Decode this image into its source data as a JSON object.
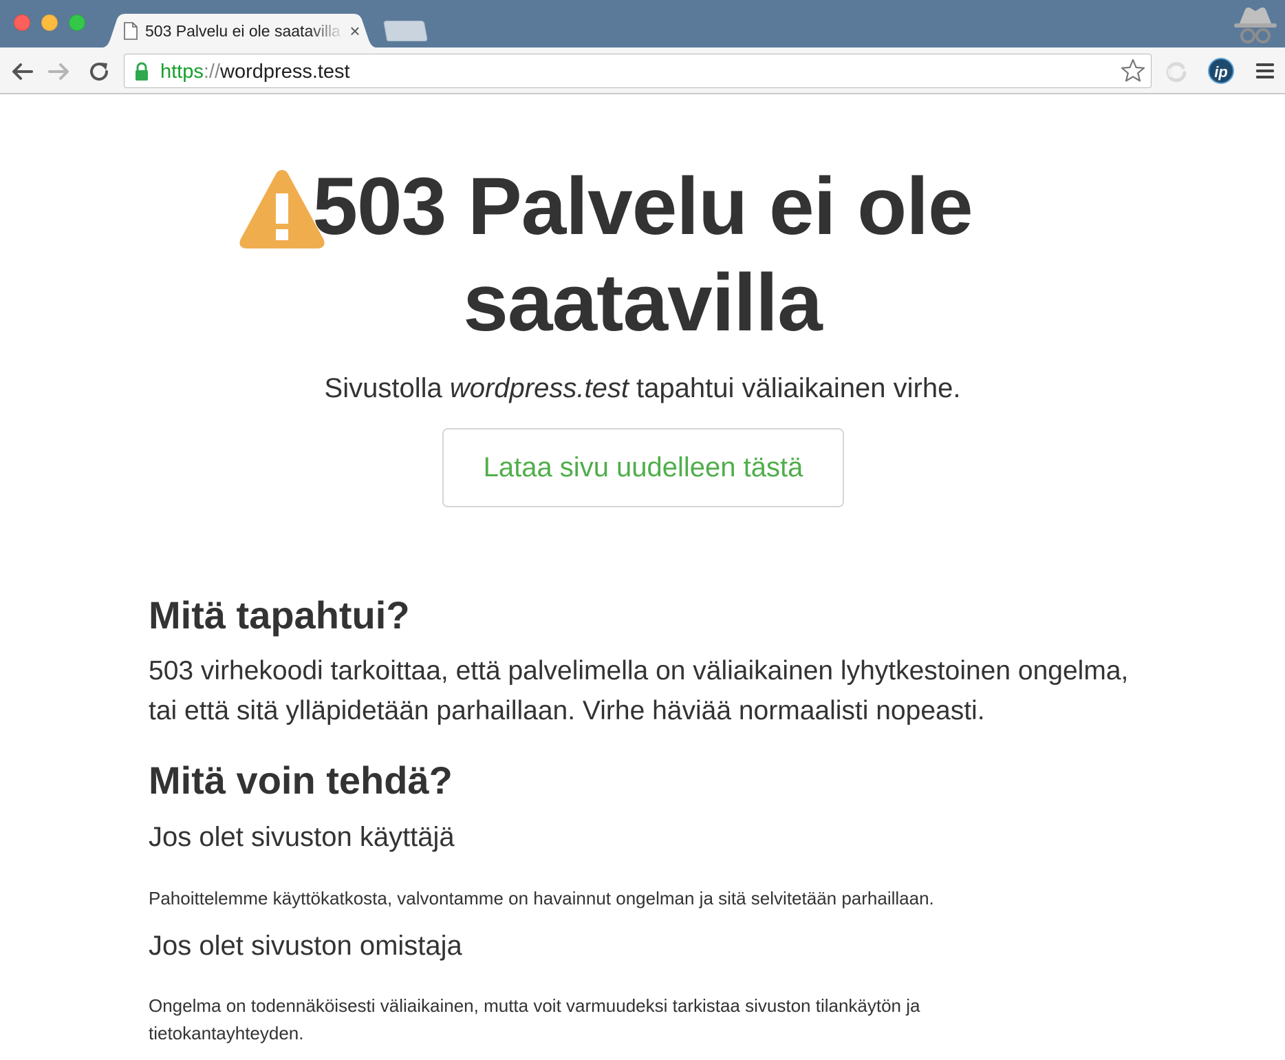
{
  "browser": {
    "tab": {
      "title": "503 Palvelu ei ole saatavilla",
      "close_glyph": "×"
    },
    "address_bar": {
      "scheme": "https",
      "separator": "://",
      "host": "wordpress.test"
    },
    "extensions": {
      "ip_badge": "ip"
    }
  },
  "page": {
    "headline": "503 Palvelu ei ole saatavilla",
    "subtitle_prefix": "Sivustolla ",
    "subtitle_site": "wordpress.test",
    "subtitle_suffix": " tapahtui väliaikainen virhe.",
    "reload_button": "Lataa sivu uudelleen tästä",
    "what_happened": {
      "heading": "Mitä tapahtui?",
      "text": "503 virhekoodi tarkoittaa, että palvelimella on väliaikainen lyhytkestoinen ongelma, tai että sitä ylläpidetään parhaillaan. Virhe häviää normaalisti nopeasti."
    },
    "what_can_i_do": {
      "heading": "Mitä voin tehdä?",
      "user": {
        "heading": "Jos olet sivuston käyttäjä",
        "text": "Pahoittelemme käyttökatkosta, valvontamme on havainnut ongelman ja sitä selvitetään parhaillaan."
      },
      "owner": {
        "heading": "Jos olet sivuston omistaja",
        "text": "Ongelma on todennäköisesti väliaikainen, mutta voit varmuudeksi tarkistaa sivuston tilankäytön ja tietokantayhteyden."
      }
    }
  },
  "colors": {
    "warning": "#f0ad4e",
    "reload_text": "#4fae4a",
    "secure_scheme": "#179f2b",
    "titlebar": "#5b7a9a"
  }
}
